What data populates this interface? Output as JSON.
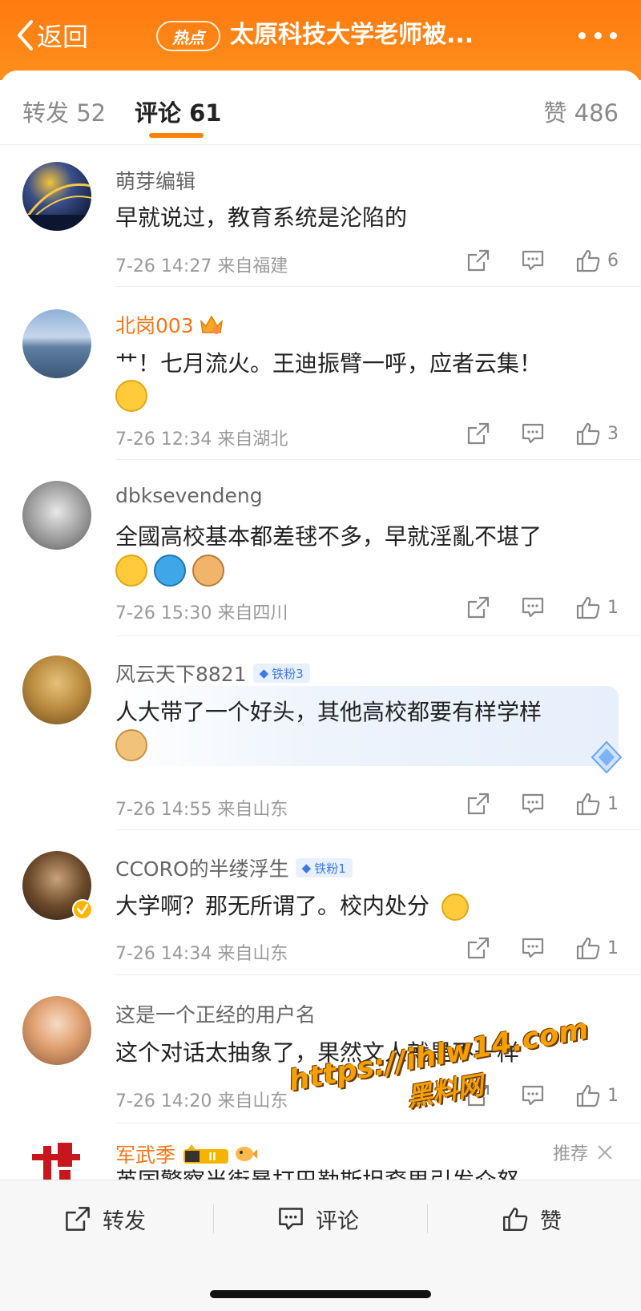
{
  "nav": {
    "back_label": "返回",
    "hot_label": "热点",
    "title": "太原科技大学老师被..."
  },
  "tabs": {
    "repost": "转发 52",
    "comment": "评论 61",
    "like": "赞 486"
  },
  "comments": [
    {
      "user": "萌芽编辑",
      "text": "早就说过，教育系统是沦陷的",
      "time": "7-26 14:27",
      "location": "来自福建",
      "likes": "6"
    },
    {
      "user": "北岗003",
      "text": "艹！七月流火。王迪振臂一呼，应者云集！",
      "time": "7-26 12:34",
      "location": "来自湖北",
      "likes": "3"
    },
    {
      "user": "dbksevendeng",
      "text": "全國高校基本都差毬不多，早就淫亂不堪了",
      "time": "7-26 15:30",
      "location": "来自四川",
      "likes": "1"
    },
    {
      "user": "风云天下8821",
      "badge": "铁粉3",
      "text": "人大带了一个好头，其他高校都要有样学样",
      "time": "7-26 14:55",
      "location": "来自山东",
      "likes": "1"
    },
    {
      "user": "CCORO的半缕浮生",
      "badge": "铁粉1",
      "text": "大学啊？那无所谓了。校内处分",
      "time": "7-26 14:34",
      "location": "来自山东",
      "likes": "1"
    },
    {
      "user": "这是一个正经的用户名",
      "text": "这个对话太抽象了，果然文人就是不一样",
      "time": "7-26 14:20",
      "location": "来自山东",
      "likes": "1"
    },
    {
      "user": "军武季",
      "recommend": "推荐",
      "text": "英国警察当街暴打巴勒斯坦裔男引发众怒"
    }
  ],
  "watermark": {
    "line1": "https://ihlw14.com",
    "line2": "黑料网"
  },
  "bottom": {
    "repost": "转发",
    "comment": "评论",
    "like": "赞"
  },
  "colors": {
    "accent": "#ff8200",
    "vip_name": "#f2761b"
  }
}
